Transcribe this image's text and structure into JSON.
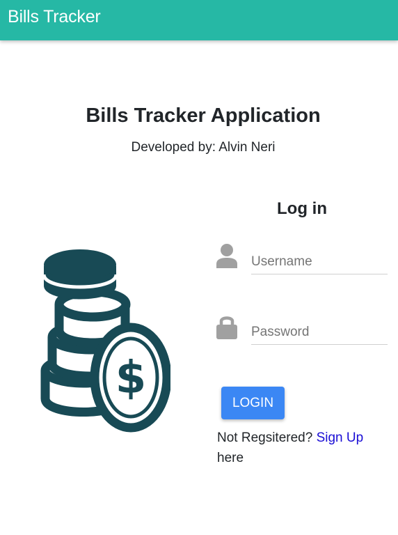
{
  "navbar": {
    "brand": "Bills Tracker",
    "color": "#26b8a5"
  },
  "header": {
    "title": "Bills Tracker Application",
    "subtitle": "Developed by: Alvin Neri"
  },
  "illustration": {
    "icon": "coin-stack-icon",
    "color": "#184a55"
  },
  "login": {
    "heading": "Log in",
    "username": {
      "icon": "user-icon",
      "placeholder": "Username",
      "value": ""
    },
    "password": {
      "icon": "lock-icon",
      "placeholder": "Password",
      "value": ""
    },
    "button_label": "LOGIN",
    "button_color": "#3b87f4",
    "signup_prompt": "Not Regsitered?",
    "signup_link": "Sign Up",
    "signup_suffix": "here"
  }
}
